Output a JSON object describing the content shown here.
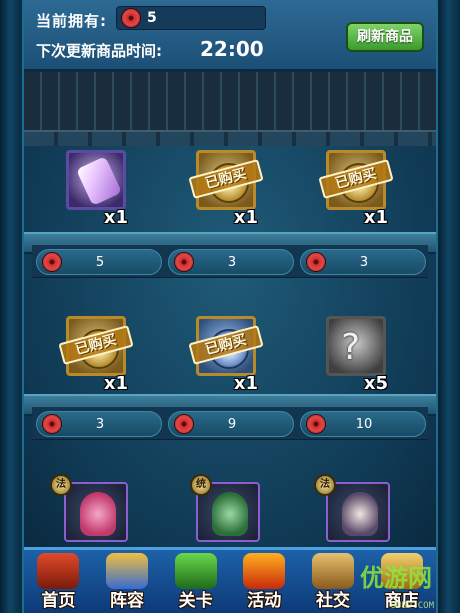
{
  "header": {
    "owned_label": "当前拥有:",
    "owned_value": "5",
    "refresh_time_label": "下次更新商品时间:",
    "refresh_time": "22:00",
    "refresh_button_label": "刷新商品"
  },
  "shelves": [
    {
      "items": [
        {
          "icon": "scroll-icon",
          "style": "purple",
          "qty": "x1",
          "sold": false,
          "price": "5"
        },
        {
          "icon": "coin-icon",
          "style": "gold",
          "qty": "x1",
          "sold": true,
          "price": "3"
        },
        {
          "icon": "coin-icon",
          "style": "gold",
          "qty": "x1",
          "sold": true,
          "price": "3"
        }
      ]
    },
    {
      "items": [
        {
          "icon": "coin-icon",
          "style": "gold",
          "qty": "x1",
          "sold": true,
          "price": "3"
        },
        {
          "icon": "coin-icon",
          "style": "blue",
          "qty": "x1",
          "sold": true,
          "price": "9"
        },
        {
          "icon": "puzzle-icon",
          "style": "gray",
          "qty": "x5",
          "sold": false,
          "price": "10"
        }
      ]
    },
    {
      "items": [
        {
          "icon": "hero-portrait",
          "badge": "法"
        },
        {
          "icon": "hero-portrait",
          "badge": "统"
        },
        {
          "icon": "hero-portrait",
          "badge": "法"
        }
      ]
    }
  ],
  "sold_stamp_label": "已购买",
  "nav": [
    {
      "label": "首页",
      "icon": "home-icon"
    },
    {
      "label": "阵容",
      "icon": "shield-icon"
    },
    {
      "label": "关卡",
      "icon": "map-icon"
    },
    {
      "label": "活动",
      "icon": "flame-icon"
    },
    {
      "label": "社交",
      "icon": "people-icon"
    },
    {
      "label": "商店",
      "icon": "shop-icon"
    }
  ],
  "watermark": {
    "text": "优游网",
    "sub": "UUU9.COM"
  },
  "colors": {
    "accent_green": "#3a9b2c",
    "currency_red": "#c92b2b",
    "frame_blue": "#0f4564"
  }
}
